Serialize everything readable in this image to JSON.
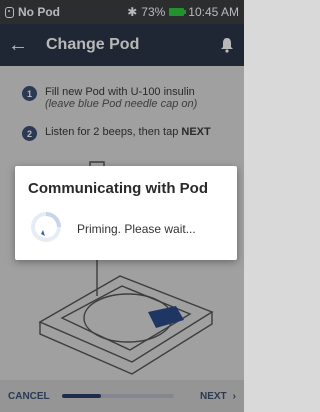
{
  "status_bar": {
    "pod_status": "No Pod",
    "battery": "73%",
    "time": "10:45 AM",
    "icons": [
      "pod-icon",
      "bluetooth-icon",
      "battery-icon"
    ]
  },
  "header": {
    "title": "Change Pod",
    "icons": [
      "back-arrow-icon",
      "bell-icon"
    ]
  },
  "steps": [
    {
      "number": "1",
      "text": "Fill new Pod with U-100 insulin",
      "note": "(leave blue Pod needle cap on)"
    },
    {
      "number": "2",
      "text_before": "Listen for 2 beeps, then tap ",
      "text_emphasis": "NEXT"
    }
  ],
  "dialog": {
    "title": "Communicating with Pod",
    "message": "Priming. Please wait..."
  },
  "footer": {
    "cancel_label": "CANCEL",
    "next_label": "NEXT",
    "progress_fraction": 0.35
  },
  "colors": {
    "header": "#2c3548",
    "accent": "#3d4f73",
    "status_bar": "#3d3f42",
    "battery": "#2ecc40"
  }
}
